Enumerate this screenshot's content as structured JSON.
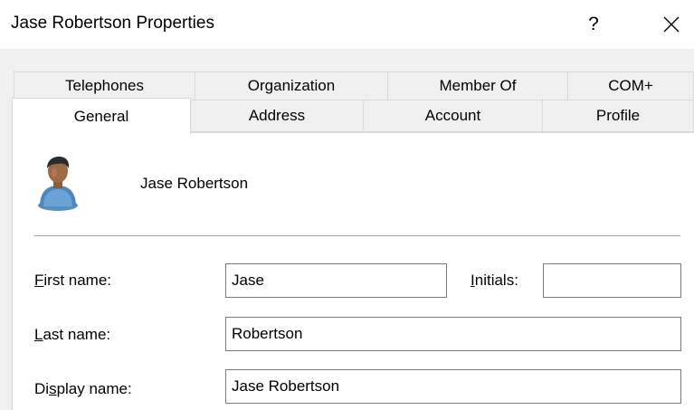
{
  "window": {
    "title": "Jase Robertson Properties",
    "help_label": "?"
  },
  "tabs": {
    "row1": [
      "Telephones",
      "Organization",
      "Member Of",
      "COM+"
    ],
    "row2": [
      "General",
      "Address",
      "Account",
      "Profile"
    ],
    "selected": "General"
  },
  "general": {
    "display_name_header": "Jase Robertson",
    "first_name": {
      "label_prefix": "",
      "label_mnemonic": "F",
      "label_rest": "irst name:",
      "value": "Jase"
    },
    "initials": {
      "label_prefix": "",
      "label_mnemonic": "I",
      "label_rest": "nitials:",
      "value": ""
    },
    "last_name": {
      "label_prefix": "",
      "label_mnemonic": "L",
      "label_rest": "ast name:",
      "value": "Robertson"
    },
    "display_name": {
      "label_prefix": "Di",
      "label_mnemonic": "s",
      "label_rest": "play name:",
      "value": "Jase Robertson"
    }
  },
  "icons": {
    "user": "user-avatar-icon",
    "close": "close-icon"
  }
}
